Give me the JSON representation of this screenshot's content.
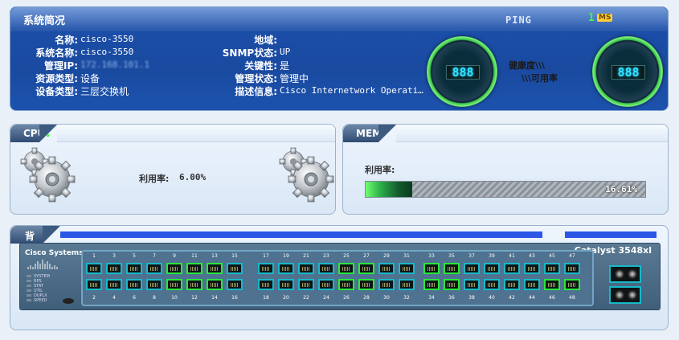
{
  "summary": {
    "title": "系统简况",
    "ping_label": "PING",
    "ping_value": "1",
    "ping_unit": "MS",
    "rows_left": [
      {
        "label": "名称:",
        "value": "cisco-3550"
      },
      {
        "label": "系统名称:",
        "value": "cisco-3550"
      },
      {
        "label": "管理IP:",
        "value": "172.168.101.1"
      },
      {
        "label": "资源类型:",
        "value": "设备"
      },
      {
        "label": "设备类型:",
        "value": "三层交换机"
      }
    ],
    "rows_right": [
      {
        "label": "地域:",
        "value": ""
      },
      {
        "label": "SNMP状态:",
        "value": "UP"
      },
      {
        "label": "关键性:",
        "value": "是"
      },
      {
        "label": "管理状态:",
        "value": "管理中"
      },
      {
        "label": "描述信息:",
        "value": "Cisco Internetwork Operati…"
      }
    ],
    "health_gauge": {
      "digits": "888",
      "label": "健康度\\\\\\"
    },
    "avail_gauge": {
      "digits": "888",
      "label": "\\\\\\可用率"
    }
  },
  "cpu": {
    "title": "CPU",
    "usage_label": "利用率:",
    "usage_value": "6.00%"
  },
  "mem": {
    "title": "MEM",
    "usage_label": "利用率:",
    "usage_value": "16.61%",
    "usage_fraction": 0.1661
  },
  "backplane": {
    "title": "背板",
    "brand": "Cisco Systems",
    "model": "Catalyst 3548xl",
    "leds": [
      "SYSTEM",
      "RPS",
      "STAT",
      "UTIL",
      "DUPLX",
      "SPEED"
    ],
    "top_ports": [
      "1",
      "3",
      "5",
      "7",
      "9",
      "11",
      "13",
      "15",
      "17",
      "19",
      "21",
      "23",
      "25",
      "27",
      "29",
      "31",
      "33",
      "35",
      "37",
      "39",
      "41",
      "43",
      "45",
      "47"
    ],
    "bottom_ports": [
      "2",
      "4",
      "6",
      "8",
      "10",
      "12",
      "14",
      "16",
      "18",
      "20",
      "22",
      "24",
      "26",
      "28",
      "30",
      "32",
      "34",
      "36",
      "38",
      "40",
      "42",
      "44",
      "46",
      "48"
    ],
    "top_port_status": [
      "up",
      "up",
      "up",
      "up",
      "green",
      "green",
      "green",
      "up",
      "up",
      "up",
      "up",
      "up",
      "green",
      "green",
      "up",
      "up",
      "green",
      "green",
      "up",
      "up",
      "up",
      "up",
      "up",
      "up"
    ],
    "bottom_port_status": [
      "up",
      "up",
      "up",
      "up",
      "green",
      "green",
      "green",
      "up",
      "up",
      "up",
      "up",
      "up",
      "green",
      "green",
      "up",
      "up",
      "green",
      "green",
      "up",
      "up",
      "up",
      "up",
      "green",
      "green"
    ]
  }
}
